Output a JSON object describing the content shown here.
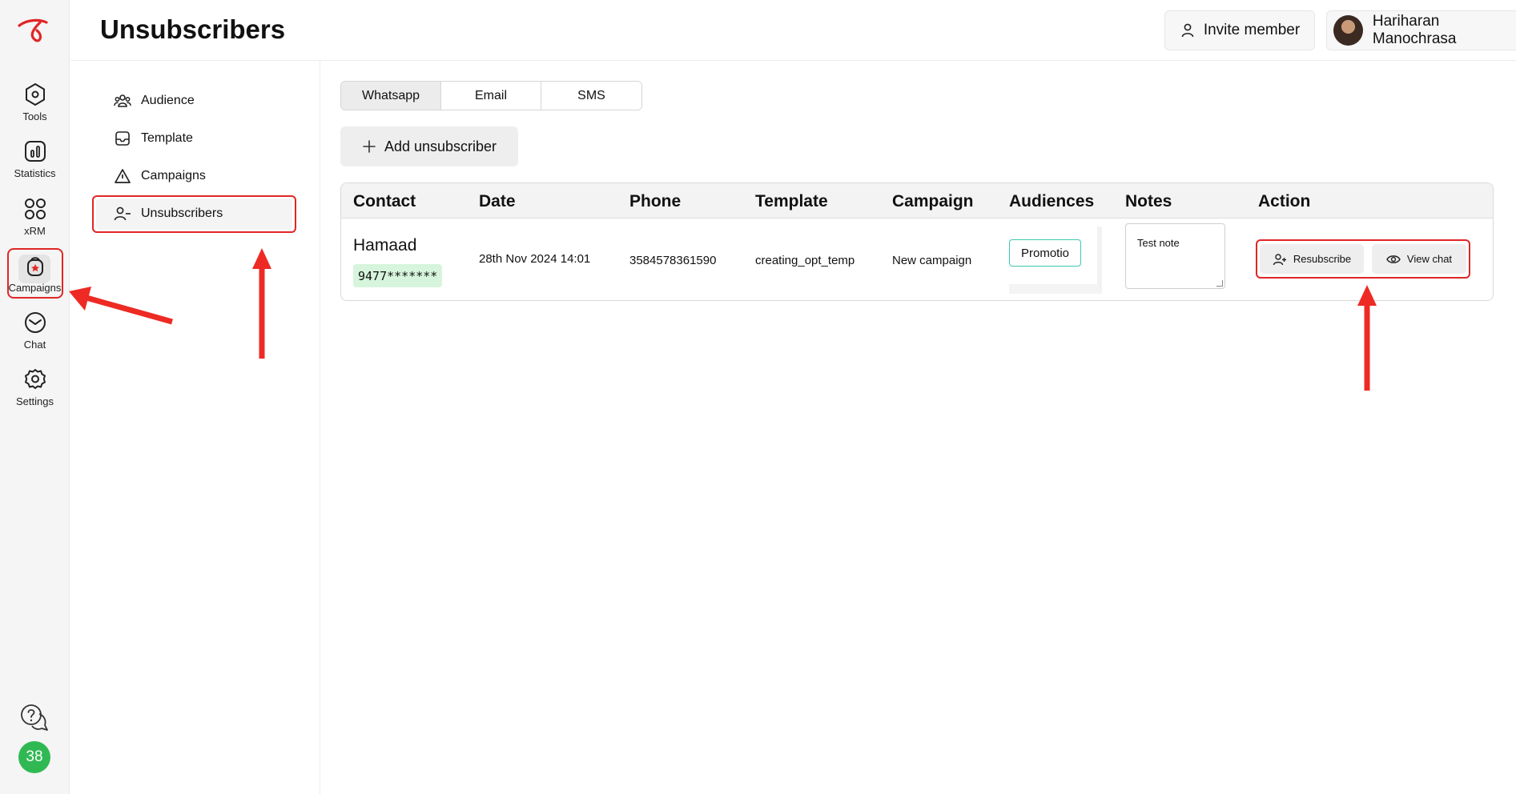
{
  "header": {
    "title": "Unsubscribers",
    "invite_label": "Invite member",
    "user_name": "Hariharan Manochrasa"
  },
  "rail": {
    "items": [
      {
        "label": "Tools",
        "icon": "hexagon-icon"
      },
      {
        "label": "Statistics",
        "icon": "bar-chart-icon"
      },
      {
        "label": "xRM",
        "icon": "grid-icon"
      },
      {
        "label": "Campaigns",
        "icon": "campaign-bag-icon"
      },
      {
        "label": "Chat",
        "icon": "chat-icon"
      },
      {
        "label": "Settings",
        "icon": "gear-icon"
      }
    ],
    "notification_count": "38"
  },
  "subnav": {
    "items": [
      {
        "label": "Audience",
        "icon": "audience-icon"
      },
      {
        "label": "Template",
        "icon": "template-icon"
      },
      {
        "label": "Campaigns",
        "icon": "campaign-icon"
      },
      {
        "label": "Unsubscribers",
        "icon": "user-minus-icon"
      }
    ]
  },
  "tabs": [
    "Whatsapp",
    "Email",
    "SMS"
  ],
  "add_button_label": "Add unsubscriber",
  "table": {
    "headers": [
      "Contact",
      "Date",
      "Phone",
      "Template",
      "Campaign",
      "Audiences",
      "Notes",
      "Action"
    ],
    "rows": [
      {
        "contact_name": "Hamaad",
        "contact_phone": "9477*******",
        "date": "28th Nov 2024 14:01",
        "phone": "3584578361590",
        "template": "creating_opt_temp",
        "campaign": "New campaign",
        "audience": "Promotio",
        "notes": "Test note",
        "resubscribe_label": "Resubscribe",
        "view_chat_label": "View chat"
      }
    ]
  },
  "colors": {
    "accent_red": "#e02626",
    "badge_green": "#30b953",
    "phone_badge_bg": "#d6f5dc",
    "audience_border": "#3cc9b0"
  }
}
